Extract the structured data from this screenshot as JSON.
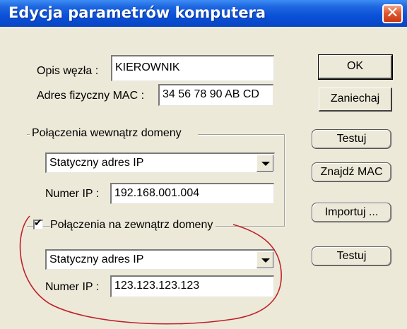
{
  "window": {
    "title": "Edycja parametrów komputera",
    "close_glyph": "✕"
  },
  "node": {
    "desc_label": "Opis węzła :",
    "desc_value": "KIEROWNIK",
    "mac_label": "Adres fizyczny MAC :",
    "mac_value": "34 56 78 90 AB CD"
  },
  "internal": {
    "group_label": "Połączenia wewnątrz domeny",
    "ip_type": "Statyczny adres IP",
    "ip_label": "Numer IP :",
    "ip_value": "192.168.001.004"
  },
  "external": {
    "checked": true,
    "check_glyph": "✔",
    "group_label": "Połączenia na zewnątrz domeny",
    "ip_type": "Statyczny adres IP",
    "ip_label": "Numer IP :",
    "ip_value": "123.123.123.123"
  },
  "buttons": {
    "ok": "OK",
    "cancel": "Zaniechaj",
    "test_internal": "Testuj",
    "find_mac": "Znajdź MAC",
    "import": "Importuj ...",
    "test_external": "Testuj"
  },
  "annotation": {
    "shape": "hand-drawn-ellipse",
    "color": "#c0202a"
  }
}
